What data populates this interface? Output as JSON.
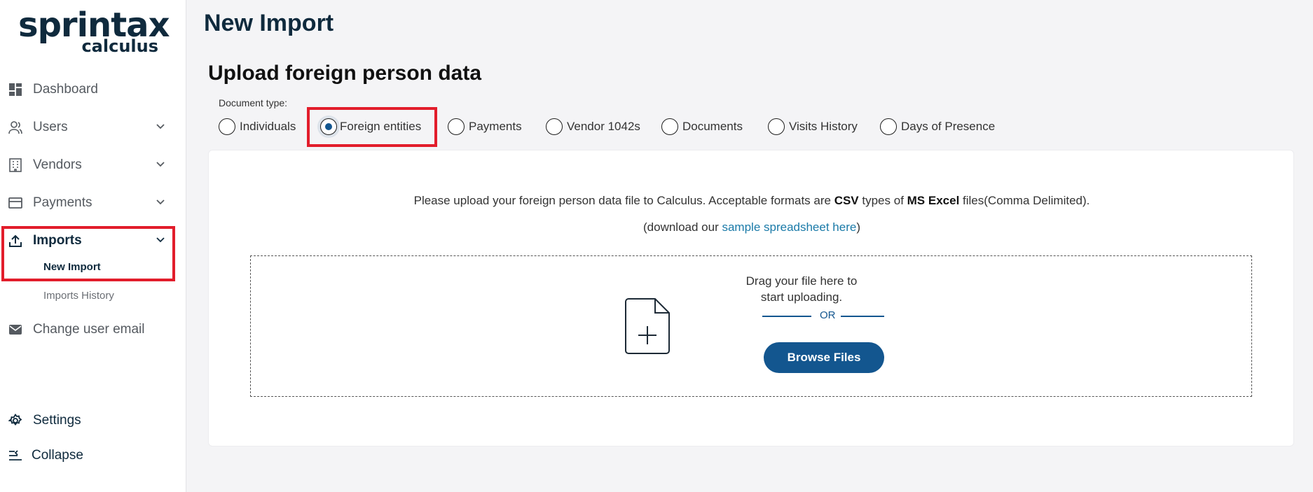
{
  "logo": {
    "line1": "sprintax",
    "line2": "calculus"
  },
  "sidebar": {
    "items": [
      {
        "label": "Dashboard",
        "icon": "dashboard-icon"
      },
      {
        "label": "Users",
        "icon": "user-icon"
      },
      {
        "label": "Vendors",
        "icon": "building-icon"
      },
      {
        "label": "Payments",
        "icon": "card-icon"
      },
      {
        "label": "Imports",
        "icon": "upload-icon"
      },
      {
        "label": "Change user email",
        "icon": "mail-icon"
      }
    ],
    "imports_sub": [
      {
        "label": "New Import"
      },
      {
        "label": "Imports History"
      }
    ],
    "settings_label": "Settings",
    "collapse_label": "Collapse"
  },
  "main": {
    "page_title": "New Import",
    "section_title": "Upload foreign person data",
    "doc_type_label": "Document type:",
    "doc_types": [
      {
        "label": "Individuals",
        "checked": false
      },
      {
        "label": "Foreign entities",
        "checked": true
      },
      {
        "label": "Payments",
        "checked": false
      },
      {
        "label": "Vendor 1042s",
        "checked": false
      },
      {
        "label": "Documents",
        "checked": false
      },
      {
        "label": "Visits History",
        "checked": false
      },
      {
        "label": "Days of Presence",
        "checked": false
      }
    ],
    "upload": {
      "info_part1": "Please upload your foreign person data file to Calculus. Acceptable formats are ",
      "info_csv": "CSV",
      "info_part2": " types of ",
      "info_excel": "MS Excel",
      "info_part3": " files(Comma Delimited).",
      "download_prefix": "(download our ",
      "download_link": "sample spreadsheet here",
      "download_suffix": ")",
      "drag_text": "Drag your file here to start uploading.",
      "or_text": "OR",
      "browse_label": "Browse Files"
    }
  },
  "colors": {
    "accent": "#13568f",
    "highlight": "#e21d2b",
    "link": "#1a7aa8"
  }
}
